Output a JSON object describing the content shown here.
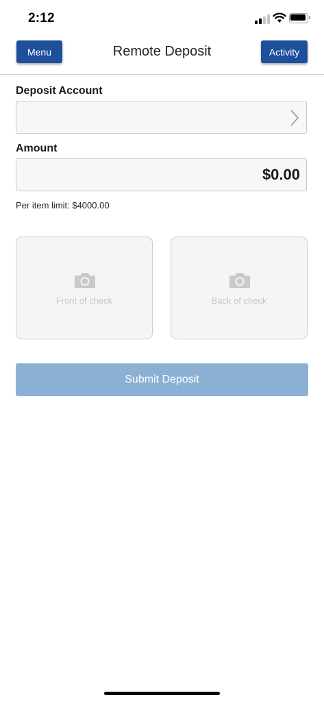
{
  "status_bar": {
    "time": "2:12",
    "icons": [
      "signal-icon",
      "wifi-icon",
      "battery-icon"
    ]
  },
  "nav": {
    "menu_label": "Menu",
    "title": "Remote Deposit",
    "activity_label": "Activity"
  },
  "form": {
    "account_label": "Deposit Account",
    "account_value": "",
    "amount_label": "Amount",
    "amount_value": "$0.00",
    "limit_text": "Per item limit: $4000.00"
  },
  "checks": {
    "front_label": "Front of check",
    "back_label": "Back of check",
    "icon": "camera-icon"
  },
  "submit_label": "Submit Deposit",
  "colors": {
    "primary": "#1e4f9c",
    "submit_disabled": "#8bb0d3",
    "field_background": "#f7f7f7",
    "border": "#c9c9c9",
    "placeholder_text": "#c7c7c7"
  }
}
